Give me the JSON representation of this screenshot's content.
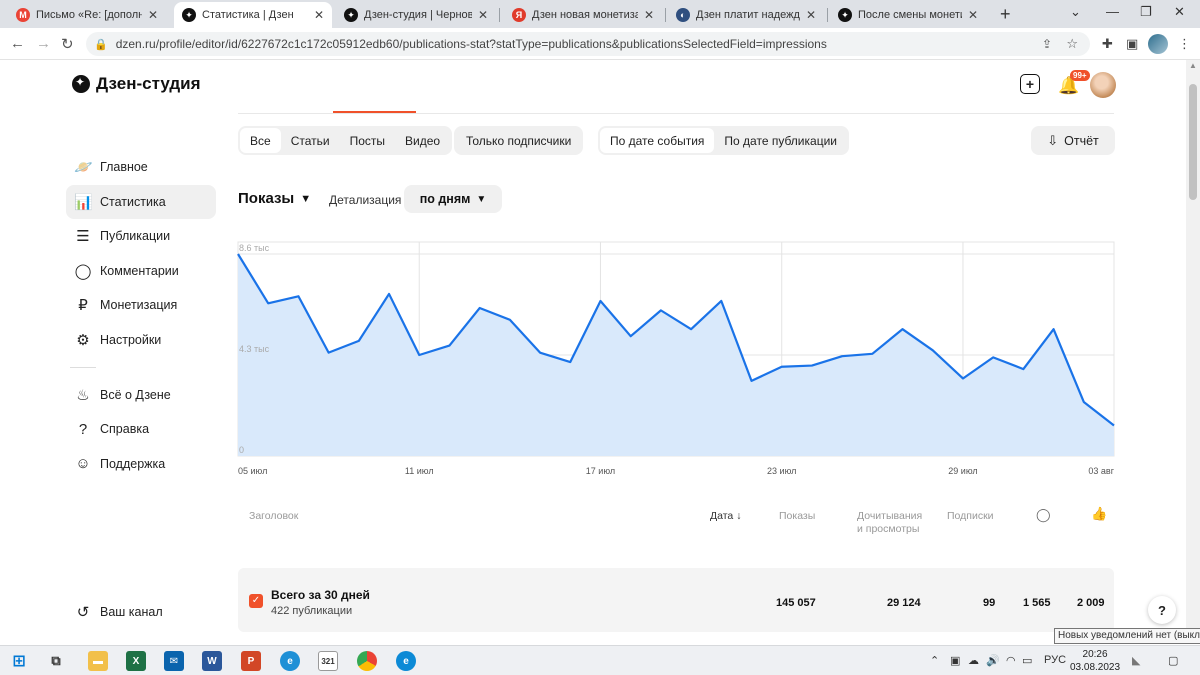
{
  "browser": {
    "tabs": [
      {
        "title": "Письмо «Re: [дополнение]",
        "fav_color": "#ea4335",
        "fav_glyph": "M",
        "active": false
      },
      {
        "title": "Статистика | Дзен",
        "fav_color": "#111111",
        "fav_glyph": "✦",
        "active": true
      },
      {
        "title": "Дзен-студия | Черновик | Л",
        "fav_color": "#111111",
        "fav_glyph": "✦",
        "active": false
      },
      {
        "title": "Дзен новая монетизация з",
        "fav_color": "#e03b2b",
        "fav_glyph": "Я",
        "active": false
      },
      {
        "title": "Дзен платит надеждами —",
        "fav_color": "#2f4f7f",
        "fav_glyph": "◐",
        "active": false
      },
      {
        "title": "После смены монетизаци",
        "fav_color": "#111111",
        "fav_glyph": "✦",
        "active": false
      }
    ],
    "new_tab": "+",
    "url": "dzen.ru/profile/editor/id/6227672c1c172c05912edb60/publications-stat?statType=publications&publicationsSelectedField=impressions"
  },
  "app": {
    "brand": "Дзен-студия",
    "sidebar": [
      {
        "label": "Главное",
        "icon": "planet-icon",
        "glyph": "🪐"
      },
      {
        "label": "Статистика",
        "icon": "stats-icon",
        "glyph": "📊",
        "active": true
      },
      {
        "label": "Публикации",
        "icon": "publications-icon",
        "glyph": "☰"
      },
      {
        "label": "Комментарии",
        "icon": "comment-icon",
        "glyph": "◯"
      },
      {
        "label": "Монетизация",
        "icon": "ruble-icon",
        "glyph": "₽"
      },
      {
        "label": "Настройки",
        "icon": "gear-icon",
        "glyph": "⚙"
      }
    ],
    "sidebar_secondary": [
      {
        "label": "Всё о Дзене",
        "icon": "flame-icon",
        "glyph": "♨"
      },
      {
        "label": "Справка",
        "icon": "help-icon",
        "glyph": "?"
      },
      {
        "label": "Поддержка",
        "icon": "support-icon",
        "glyph": "☺"
      }
    ],
    "your_channel": "Ваш канал",
    "notifications_badge": "99+"
  },
  "filters": {
    "content_types": [
      "Все",
      "Статьи",
      "Посты",
      "Видео"
    ],
    "subscribers_only": "Только подписчики",
    "date_modes": [
      "По дате события",
      "По дате публикации"
    ],
    "report": "Отчёт"
  },
  "metric": {
    "label": "Показы",
    "detail_label": "Детализация",
    "detail_value": "по дням"
  },
  "chart_data": {
    "type": "area",
    "y_ticks": [
      "8.6 тыс",
      "4.3 тыс",
      "0"
    ],
    "x_ticks": [
      "05 июл",
      "11 июл",
      "17 июл",
      "23 июл",
      "29 июл",
      "03 авг"
    ],
    "ylim": [
      0,
      8600
    ],
    "grid": true,
    "color": "#1a73e8",
    "fill": "#d9e9fb",
    "x": [
      "05 июл",
      "06 июл",
      "07 июл",
      "08 июл",
      "09 июл",
      "10 июл",
      "11 июл",
      "12 июл",
      "13 июл",
      "14 июл",
      "15 июл",
      "16 июл",
      "17 июл",
      "18 июл",
      "19 июл",
      "20 июл",
      "21 июл",
      "22 июл",
      "23 июл",
      "24 июл",
      "25 июл",
      "26 июл",
      "27 июл",
      "28 июл",
      "29 июл",
      "30 июл",
      "31 июл",
      "01 авг",
      "02 авг",
      "03 авг"
    ],
    "values": [
      8600,
      6500,
      6800,
      4400,
      4900,
      6900,
      4300,
      4700,
      6300,
      5800,
      4400,
      4000,
      6600,
      5100,
      6200,
      5400,
      6600,
      3200,
      3800,
      3850,
      4250,
      4350,
      5400,
      4500,
      3300,
      4200,
      3700,
      5400,
      2300,
      1300
    ]
  },
  "table": {
    "headers": {
      "title": "Заголовок",
      "date": "Дата",
      "impressions": "Показы",
      "reads_line1": "Дочитывания",
      "reads_line2": "и просмотры",
      "subs": "Подписки"
    },
    "total": {
      "title": "Всего за 30 дней",
      "subtitle": "422 публикации",
      "impressions": "145 057",
      "reads": "29 124",
      "subs": "99",
      "comments": "1 565",
      "likes": "2 009"
    }
  },
  "tooltip": "Новых уведомлений нет (выкл.)",
  "taskbar": {
    "lang": "РУС",
    "time": "20:26",
    "date": "03.08.2023"
  }
}
